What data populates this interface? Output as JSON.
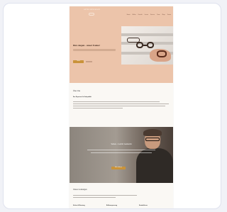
{
  "site": {
    "logo": "OPTIK HEINEMANN",
    "nav": [
      "Home",
      "Brillen",
      "Kontakt",
      "Linsen",
      "Service",
      "Team",
      "Shop",
      "Termin"
    ],
    "hero": {
      "title": "Ihre Augen - unser Fokus!",
      "cta_label": "Termin"
    },
    "about": {
      "title": "Über Uns",
      "subtitle": "Ihre Experten für Sehqualität"
    },
    "banner": {
      "title": "Sehen - Leicht Gemacht",
      "cta_label": "Mehr erfahren"
    },
    "services": {
      "title": "Unsere Leistungen",
      "columns": [
        "Sehtest & Beratung",
        "Brillenanpassung",
        "Kontaktlinsen"
      ]
    }
  },
  "colors": {
    "hero_background": "#ecc4aa",
    "accent": "#c9933a",
    "page_background": "#faf8f4"
  }
}
